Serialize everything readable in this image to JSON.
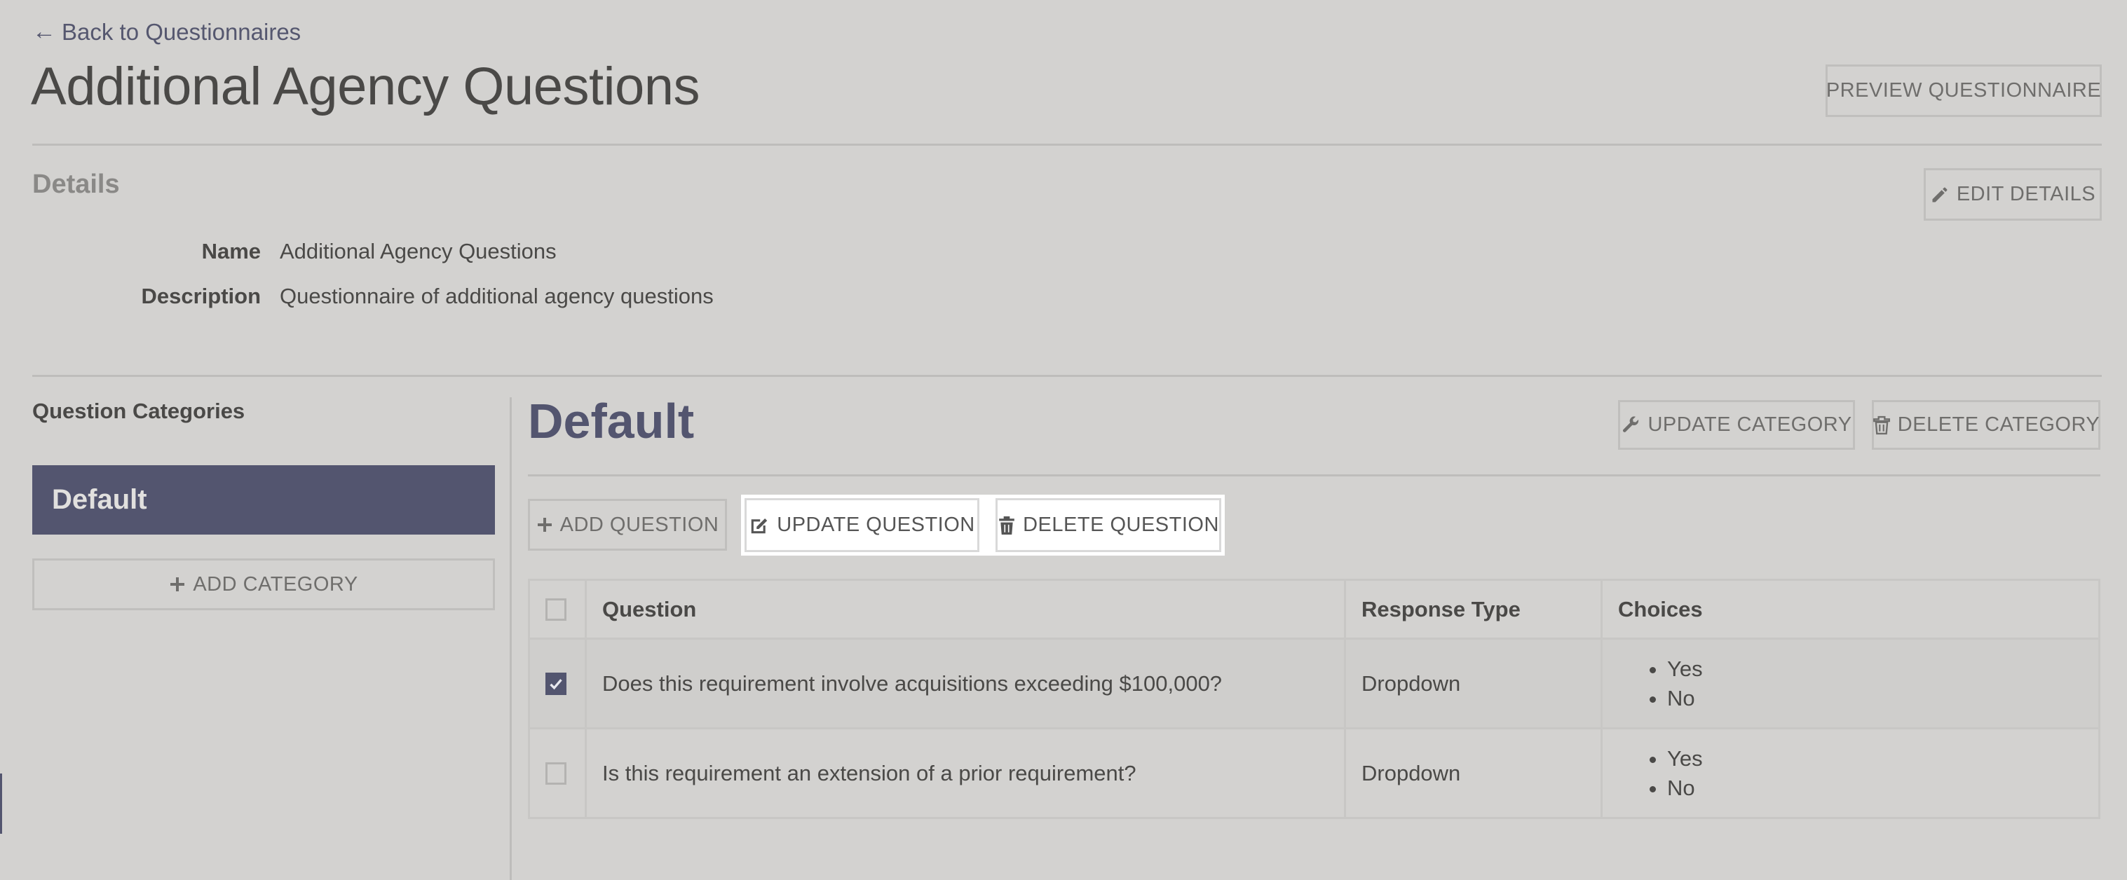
{
  "nav": {
    "back_arrow": "←",
    "back_label": "Back to Questionnaires"
  },
  "header": {
    "title": "Additional Agency Questions",
    "preview_button": "PREVIEW QUESTIONNAIRE"
  },
  "details": {
    "heading": "Details",
    "edit_button": "EDIT DETAILS",
    "fields": [
      {
        "label": "Name",
        "value": "Additional Agency Questions"
      },
      {
        "label": "Description",
        "value": "Questionnaire of additional agency questions"
      }
    ]
  },
  "categories": {
    "heading": "Question Categories",
    "items": [
      {
        "label": "Default",
        "active": true
      }
    ],
    "add_button": "ADD CATEGORY"
  },
  "category_view": {
    "title": "Default",
    "update_category": "UPDATE CATEGORY",
    "delete_category": "DELETE CATEGORY",
    "add_question": "ADD QUESTION",
    "update_question": "UPDATE QUESTION",
    "delete_question": "DELETE QUESTION"
  },
  "table": {
    "columns": [
      "Question",
      "Response Type",
      "Choices"
    ],
    "rows": [
      {
        "selected": true,
        "question": "Does this requirement involve acquisitions exceeding $100,000?",
        "response_type": "Dropdown",
        "choices": [
          "Yes",
          "No"
        ]
      },
      {
        "selected": false,
        "question": "Is this requirement an extension of a prior requirement?",
        "response_type": "Dropdown",
        "choices": [
          "Yes",
          "No"
        ]
      }
    ]
  },
  "icons": {
    "back": "arrow-left-icon",
    "edit_details": "pencil-icon",
    "add_category": "plus-icon",
    "update_category": "wrench-icon",
    "delete_category": "trash-outline-icon",
    "add_question": "plus-icon",
    "update_question": "edit-square-icon",
    "delete_question": "trash-icon",
    "checkbox_checked": "check-icon"
  },
  "colors": {
    "accent": "#53556f",
    "overlay_background": "#d3d2d0",
    "spotlight": "#ffffff"
  }
}
